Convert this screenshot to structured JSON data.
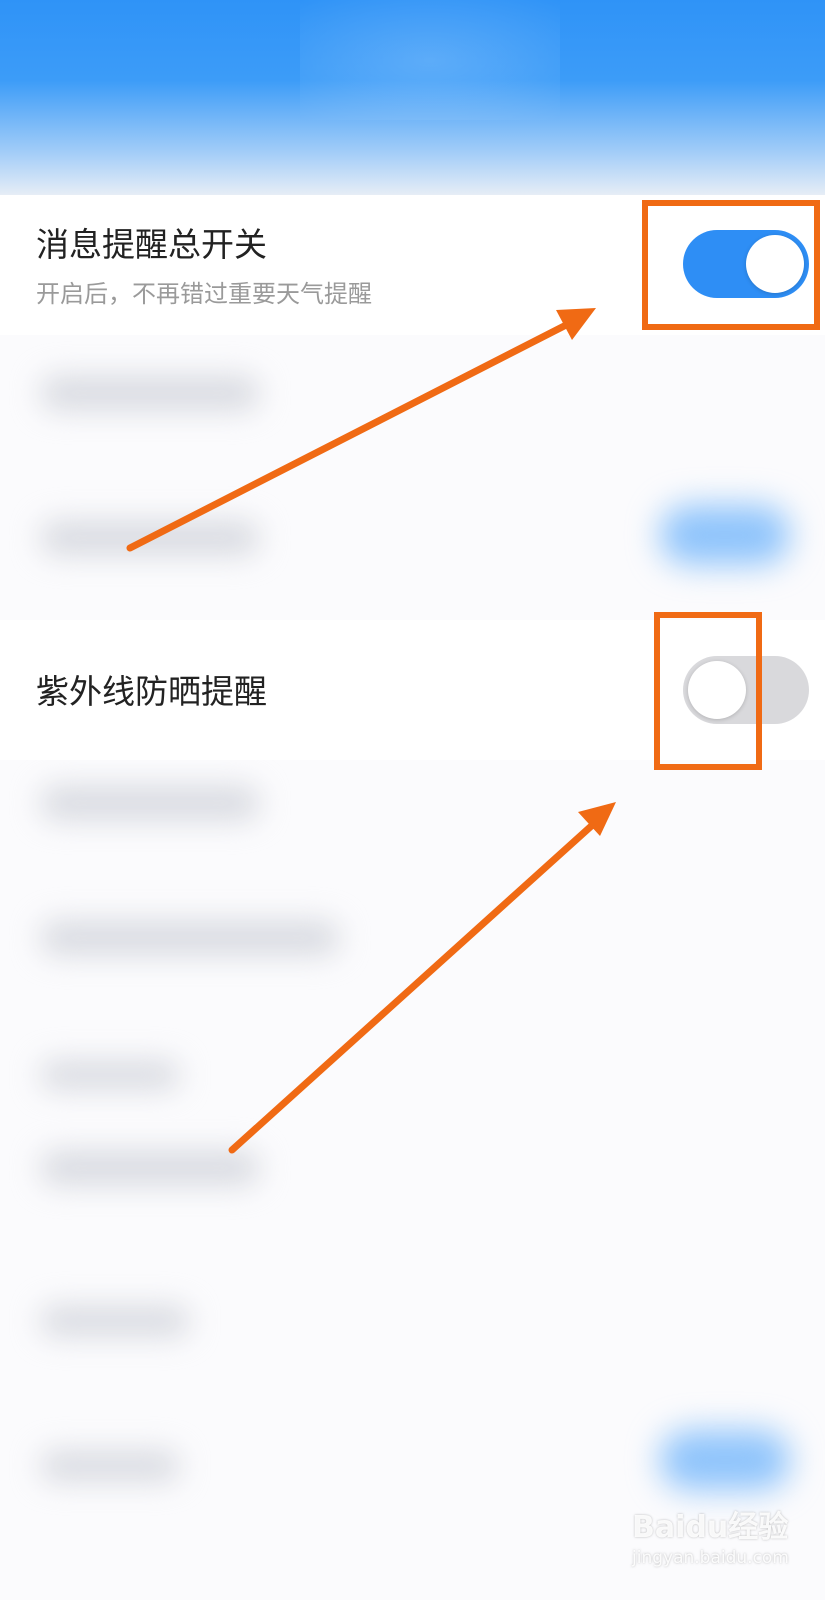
{
  "settings": {
    "master_switch": {
      "title": "消息提醒总开关",
      "subtitle": "开启后，不再错过重要天气提醒",
      "enabled": true
    },
    "uv_reminder": {
      "title": "紫外线防晒提醒",
      "enabled": false
    }
  },
  "colors": {
    "header_blue": "#2f93f7",
    "toggle_on": "#2e8ef5",
    "toggle_off": "#d9d9dc",
    "annotation_orange": "#f06a14"
  },
  "watermark": {
    "logo": "Baidu经验",
    "url": "jingyan.baidu.com"
  }
}
